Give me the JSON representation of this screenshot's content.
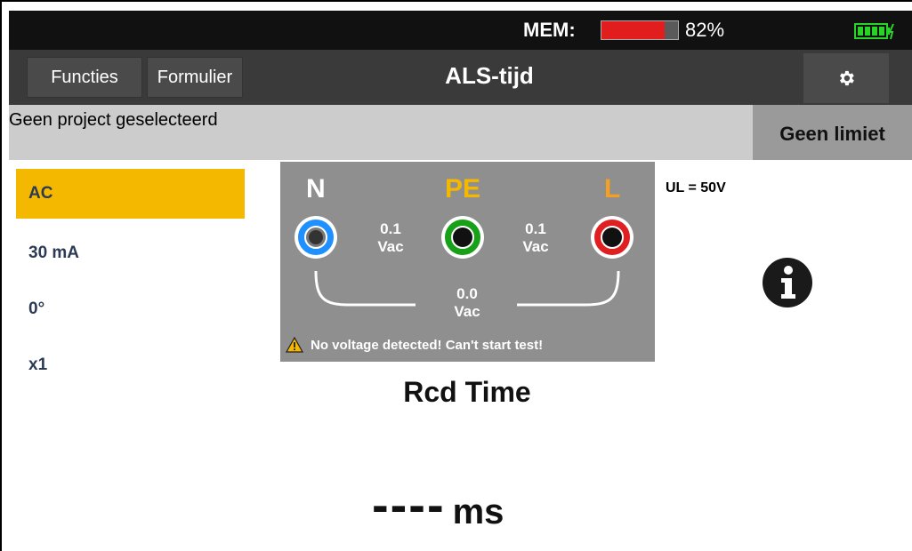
{
  "status": {
    "mem_label": "MEM:",
    "mem_percent": "82%",
    "mem_fill": 0.82,
    "mem_color": "#e21d1d",
    "battery_icon": "battery-charging-icon"
  },
  "header": {
    "functions_label": "Functies",
    "form_label": "Formulier",
    "title": "ALS-tijd",
    "settings_icon": "gear-icon"
  },
  "project": {
    "text": "Geen project geselecteerd",
    "limit": "Geen limiet"
  },
  "params": [
    {
      "label": "AC",
      "active": true
    },
    {
      "label": "30 mA",
      "active": false
    },
    {
      "label": "0°",
      "active": false
    },
    {
      "label": "x1",
      "active": false
    }
  ],
  "panel": {
    "n_label": "N",
    "pe_label": "PE",
    "l_label": "L",
    "n_pe_value": "0.1",
    "n_pe_unit": "Vac",
    "pe_l_value": "0.1",
    "pe_l_unit": "Vac",
    "n_l_value": "0.0",
    "n_l_unit": "Vac",
    "warning": "No voltage detected! Can't start test!",
    "colors": {
      "n": "#1e90ff",
      "pe": "#18a018",
      "l": "#e02020",
      "pe_label": "#f5b800",
      "l_label": "#f5a020"
    }
  },
  "ul_label": "UL = 50V",
  "measurement": {
    "title": "Rcd Time",
    "value": "----",
    "unit": "ms"
  }
}
